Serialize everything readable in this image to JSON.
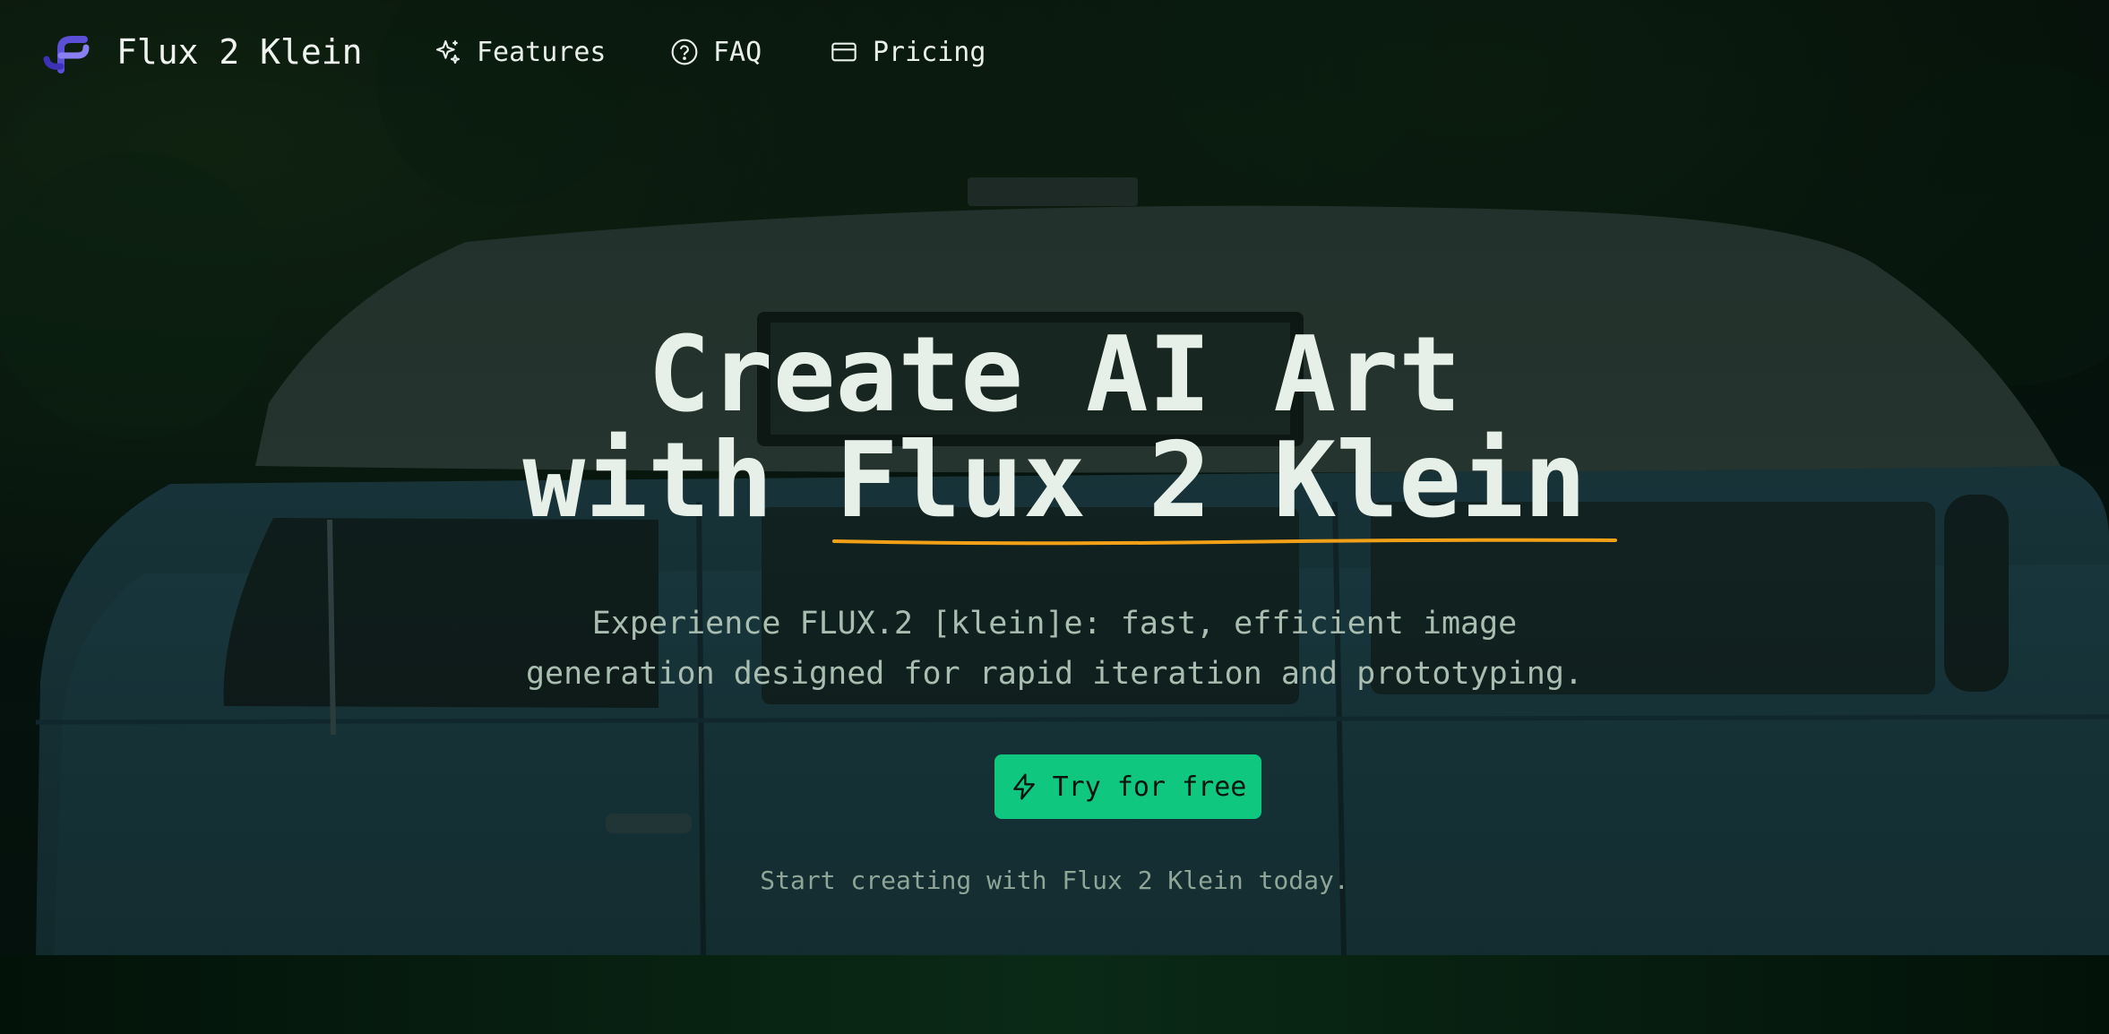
{
  "nav": {
    "brand": "Flux 2 Klein",
    "logo_icon": "flux-logo-icon",
    "items": [
      {
        "label": "Features",
        "icon": "sparkles-icon"
      },
      {
        "label": "FAQ",
        "icon": "help-circle-icon"
      },
      {
        "label": "Pricing",
        "icon": "credit-card-icon"
      }
    ]
  },
  "hero": {
    "headline_line1": "Create AI Art",
    "headline_prefix": "with ",
    "headline_highlight": "Flux 2 Klein",
    "subtitle_line1": "Experience FLUX.2 [klein]e: fast, efficient image",
    "subtitle_line2": "generation designed for rapid iteration and prototyping.",
    "cta_label": "Try for free",
    "cta_icon": "zap-icon",
    "tagline": "Start creating with Flux 2 Klein today."
  },
  "colors": {
    "accent": "#10c77f",
    "underline": "#f2a017",
    "logo": "#5b4fd8",
    "headline": "#e6f0e8"
  }
}
